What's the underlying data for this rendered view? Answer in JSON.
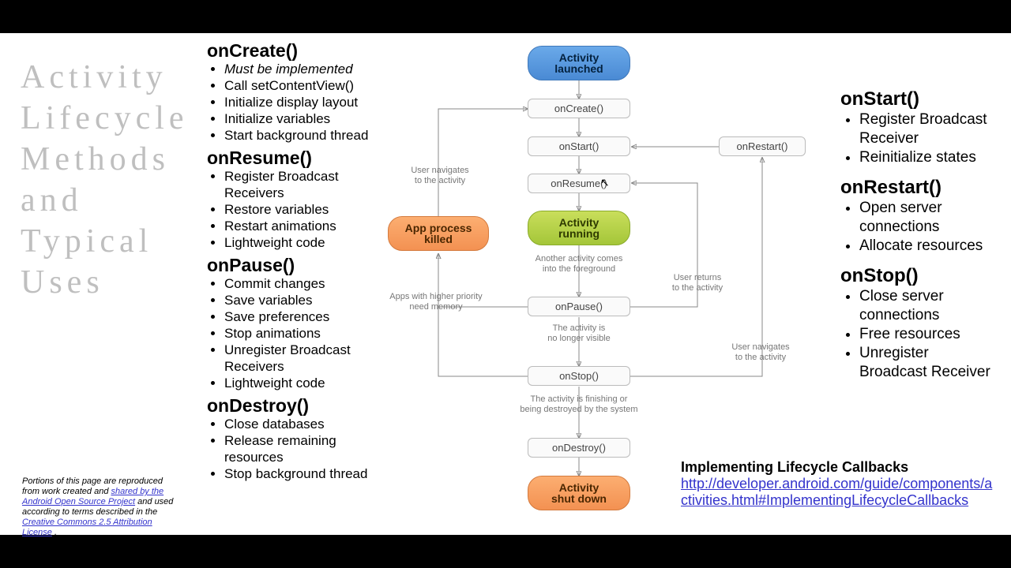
{
  "title": "Activity Lifecycle Methods and Typical Uses",
  "left": {
    "onCreate": {
      "h": "onCreate()",
      "items": [
        "*Must* be implemented",
        "Call setContentView()",
        "Initialize display layout",
        "Initialize variables",
        "Start background thread"
      ]
    },
    "onResume": {
      "h": "onResume()",
      "items": [
        "Register Broadcast Receivers",
        "Restore variables",
        "Restart animations",
        "Lightweight code"
      ]
    },
    "onPause": {
      "h": "onPause()",
      "items": [
        "Commit changes",
        "Save variables",
        "Save preferences",
        "Stop animations",
        "Unregister Broadcast Receivers",
        "Lightweight code"
      ]
    },
    "onDestroy": {
      "h": "onDestroy()",
      "items": [
        "Close databases",
        "Release remaining resources",
        "Stop background thread"
      ]
    }
  },
  "right": {
    "onStart": {
      "h": "onStart()",
      "items": [
        "Register Broadcast Receiver",
        "Reinitialize states"
      ]
    },
    "onRestart": {
      "h": "onRestart()",
      "items": [
        "Open server connections",
        "Allocate resources"
      ]
    },
    "onStop": {
      "h": "onStop()",
      "items": [
        "Close server connections",
        "Free resources",
        "Unregister Broadcast Receiver"
      ]
    }
  },
  "diagram": {
    "launched": "Activity\nlaunched",
    "onCreate": "onCreate()",
    "onStart": "onStart()",
    "onResume": "onResume()",
    "running": "Activity\nrunning",
    "onPause": "onPause()",
    "onStop": "onStop()",
    "onDestroy": "onDestroy()",
    "shutdown": "Activity\nshut down",
    "killed": "App process\nkilled",
    "onRestart": "onRestart()",
    "lbl_nav": "User navigates\nto the activity",
    "lbl_mem": "Apps with higher priority\nneed memory",
    "lbl_fg": "Another activity comes\ninto the foreground",
    "lbl_ret": "User returns\nto the activity",
    "lbl_vis": "The activity is\nno longer visible",
    "lbl_navr": "User navigates\nto the activity",
    "lbl_fin": "The activity is finishing or\nbeing destroyed by the system"
  },
  "ref": {
    "hdr": "Implementing  Lifecycle  Callbacks",
    "url": "http://developer.android.com/guide/components/activities.html#ImplementingLifecycleCallbacks"
  },
  "attrib": {
    "p1": "Portions of this page are reproduced from work created and ",
    "a1": "shared by the Android Open Source Project",
    "p2": " and used according to terms described in the ",
    "a2": "Creative Commons 2.5 Attribution License",
    "p3": "."
  }
}
